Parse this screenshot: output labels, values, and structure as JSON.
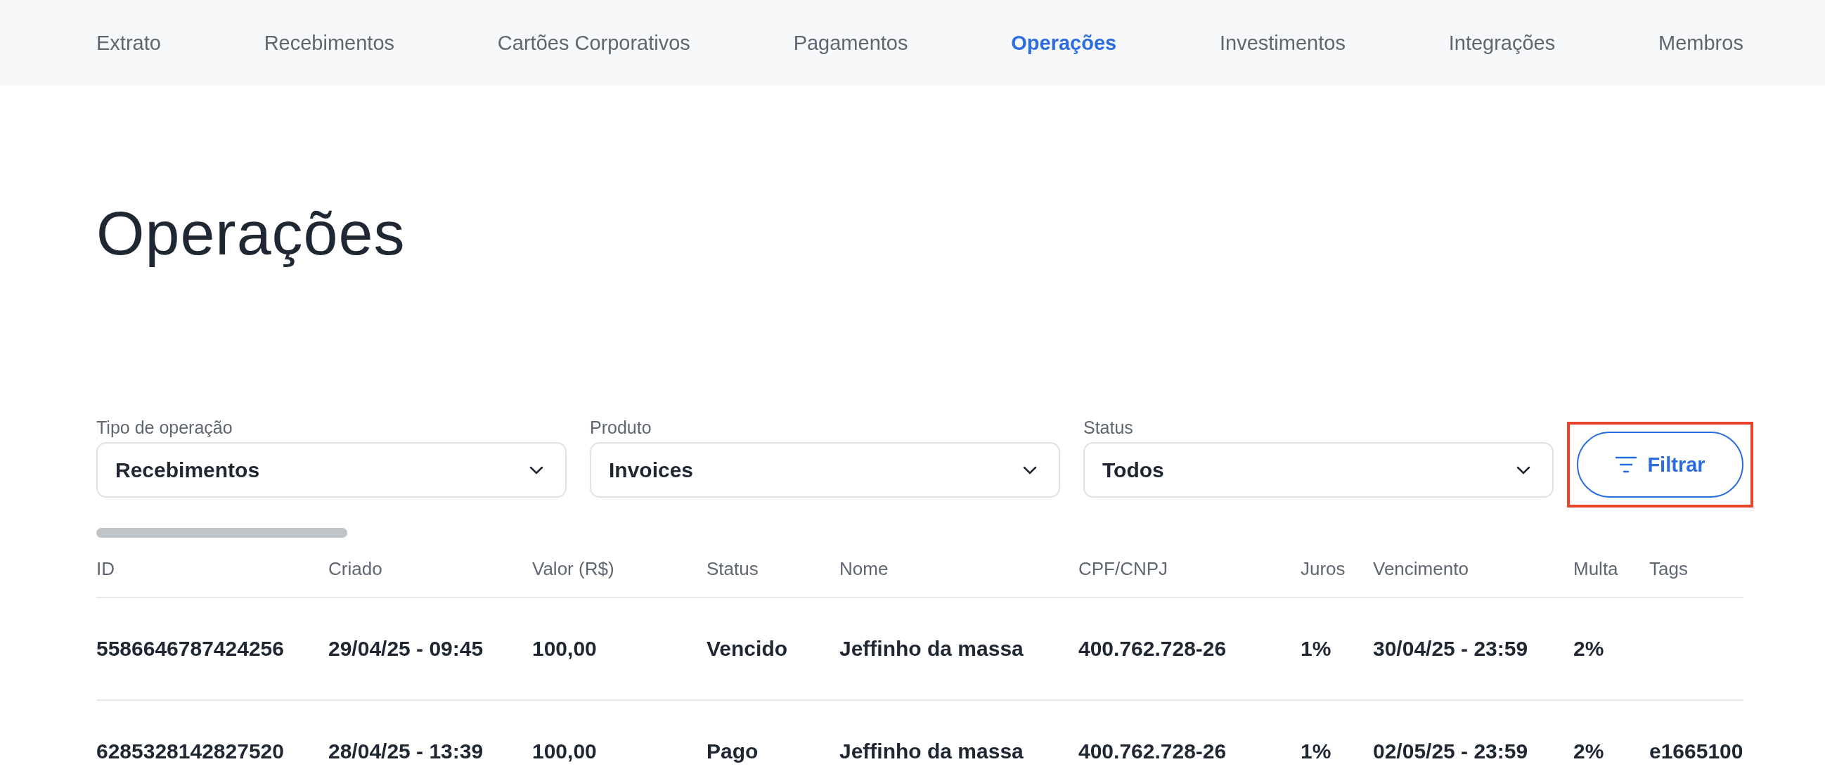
{
  "nav": {
    "items": [
      {
        "label": "Extrato",
        "selected": false
      },
      {
        "label": "Recebimentos",
        "selected": false
      },
      {
        "label": "Cartões Corporativos",
        "selected": false
      },
      {
        "label": "Pagamentos",
        "selected": false
      },
      {
        "label": "Operações",
        "selected": true
      },
      {
        "label": "Investimentos",
        "selected": false
      },
      {
        "label": "Integrações",
        "selected": false
      },
      {
        "label": "Membros",
        "selected": false
      }
    ]
  },
  "page_title": "Operações",
  "filters": [
    {
      "label": "Tipo de operação",
      "value": "Recebimentos"
    },
    {
      "label": "Produto",
      "value": "Invoices"
    },
    {
      "label": "Status",
      "value": "Todos"
    }
  ],
  "filter_button": {
    "label": "Filtrar",
    "highlighted": true
  },
  "table": {
    "columns": [
      "ID",
      "Criado",
      "Valor (R$)",
      "Status",
      "Nome",
      "CPF/CNPJ",
      "Juros",
      "Vencimento",
      "Multa",
      "Tags"
    ],
    "rows": [
      [
        "5586646787424256",
        "29/04/25 - 09:45",
        "100,00",
        "Vencido",
        "Jeffinho da massa",
        "400.762.728-26",
        "1%",
        "30/04/25 - 23:59",
        "2%",
        ""
      ],
      [
        "6285328142827520",
        "28/04/25 - 13:39",
        "100,00",
        "Pago",
        "Jeffinho da massa",
        "400.762.728-26",
        "1%",
        "02/05/25 - 23:59",
        "2%",
        "e1665100"
      ]
    ]
  }
}
